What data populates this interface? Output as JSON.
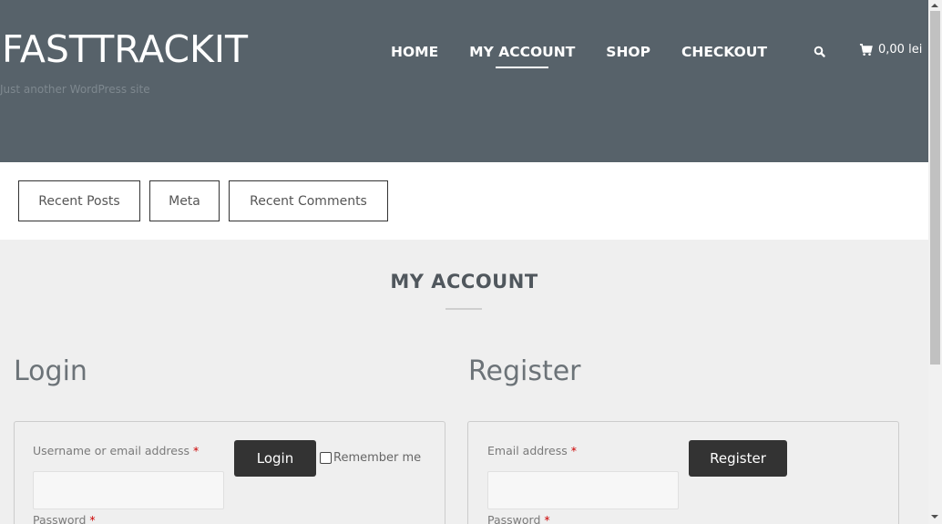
{
  "header": {
    "site_title": "FASTTRACKIT",
    "tagline": "Just another WordPress site",
    "nav": [
      "HOME",
      "MY ACCOUNT",
      "SHOP",
      "CHECKOUT"
    ],
    "cart_total": "0,00 lei"
  },
  "widget_tabs": [
    "Recent Posts",
    "Meta",
    "Recent Comments"
  ],
  "page": {
    "title": "MY ACCOUNT"
  },
  "login": {
    "heading": "Login",
    "username_label": "Username or email address",
    "password_label": "Password",
    "required_mark": "*",
    "button_label": "Login",
    "remember_label": "Remember me"
  },
  "register": {
    "heading": "Register",
    "email_label": "Email address",
    "password_label": "Password",
    "required_mark": "*",
    "button_label": "Register"
  },
  "colors": {
    "header_bg": "#57626a",
    "button_dark": "#333333",
    "page_bg": "#efefef"
  }
}
